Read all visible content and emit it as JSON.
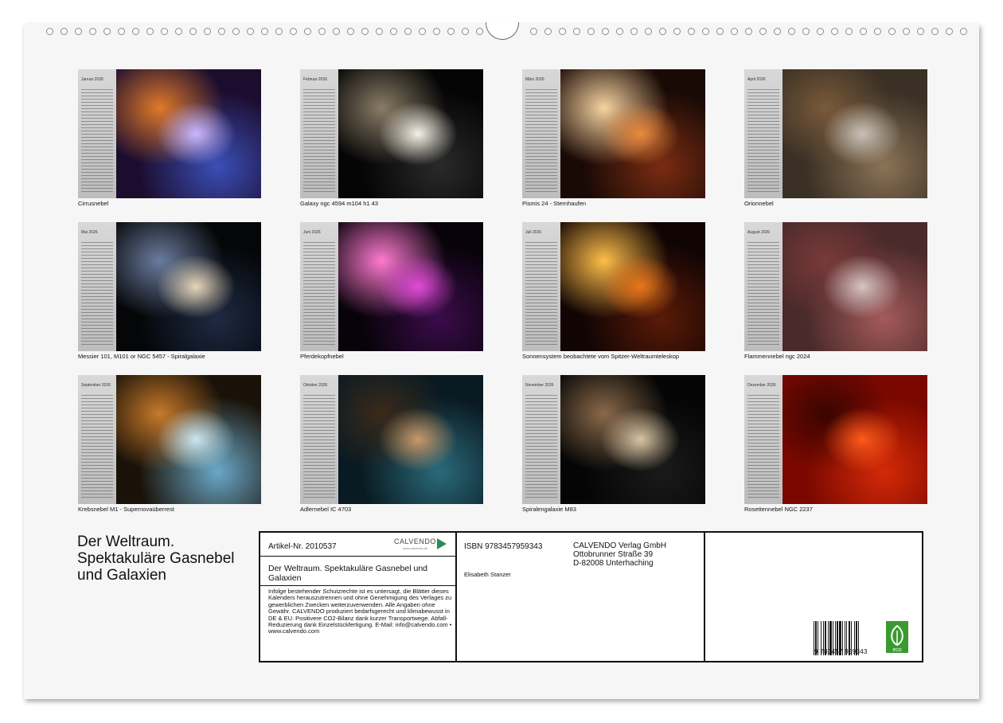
{
  "months": [
    {
      "label": "Januar 2026",
      "caption": "Cirrusnebel",
      "colors": [
        "#1c0d2e",
        "#3a4fb8",
        "#c9b6ff",
        "#e07a2a"
      ]
    },
    {
      "label": "Februar 2026",
      "caption": "Galaxy ngc 4594 m104 h1 43",
      "colors": [
        "#050505",
        "#2a2a2a",
        "#f4f1e6",
        "#8a7c66"
      ]
    },
    {
      "label": "März 2026",
      "caption": "Pismis 24 - Sternhaufen",
      "colors": [
        "#1a0a06",
        "#7a2c12",
        "#e88a3c",
        "#f6d3a0"
      ]
    },
    {
      "label": "April 2026",
      "caption": "Orionnebel",
      "colors": [
        "#3a3025",
        "#8b7356",
        "#c9c2b8",
        "#7a5a3a"
      ]
    },
    {
      "label": "Mai 2026",
      "caption": "Messier 101, M101 or NGC 5457 - Spiralgalaxie",
      "colors": [
        "#050608",
        "#1e2a44",
        "#e6d6b8",
        "#6a7c9e"
      ]
    },
    {
      "label": "Juni 2026",
      "caption": "Pferdekopfnebel",
      "colors": [
        "#08030a",
        "#3a0c4a",
        "#e04ad8",
        "#ff7ad0"
      ]
    },
    {
      "label": "Juli 2026",
      "caption": "Sonnensystem beobachtete vom Spitzer-Weltraumteleskop",
      "colors": [
        "#110503",
        "#5a1a08",
        "#e8761a",
        "#ffbe4a"
      ]
    },
    {
      "label": "August 2026",
      "caption": "Flammennebel ngc 2024",
      "colors": [
        "#4a2a2a",
        "#a45a5a",
        "#d6c4c4",
        "#7a3a3a"
      ]
    },
    {
      "label": "September 2026",
      "caption": "Krebsnebel M1 - Supernovaüberrest",
      "colors": [
        "#1a1208",
        "#6aa8c8",
        "#c8e6f0",
        "#c87a2a"
      ]
    },
    {
      "label": "Oktober 2026",
      "caption": "Adlernebel IC 4703",
      "colors": [
        "#0a1a22",
        "#2a6a7a",
        "#c89a6a",
        "#3a2a1a"
      ]
    },
    {
      "label": "November 2026",
      "caption": "Spiralengalaxie M83",
      "colors": [
        "#050505",
        "#1a1a1a",
        "#d8c4a4",
        "#8a6a4a"
      ]
    },
    {
      "label": "Dezember 2026",
      "caption": "Rosettennebel NGC 2237",
      "colors": [
        "#7a0800",
        "#d42a08",
        "#ff5a1a",
        "#3a0500"
      ]
    }
  ],
  "title": "Der Weltraum. Spektakuläre Gasnebel und Galaxien",
  "info": {
    "article": "Artikel-Nr. 2010537",
    "logo_text": "CALVENDO",
    "logo_sub": "www.calvendo.de",
    "subtitle": "Der Weltraum. Spektakuläre Gasnebel und Galaxien",
    "legal": "Infolge bestehender Schutzrechte ist es untersagt, die Blätter dieses Kalenders herauszutrennen und ohne Genehmigung des Verlages zu gewerblichen Zwecken weiterzuverwenden. Alle Angaben ohne Gewähr. CALVENDO produziert bedarfsgerecht und klimabewusst in DE & EU. Positivere CO2-Bilanz dank kurzer Transportwege. Abfall-Reduzierung dank Einzelstückfertigung. E-Mail: info@calvendo.com • www.calvendo.com",
    "isbn": "ISBN 9783457959343",
    "author": "Elisabeth Stanzer",
    "publisher_line1": "CALVENDO Verlag GmbH",
    "publisher_line2": "Ottobrunner Straße 39",
    "publisher_line3": "D-82008 Unterhaching",
    "barcode_number": "9 783457 959343",
    "eco_label": "eco"
  },
  "icons": {
    "eco": "leaf-icon",
    "logo": "calvendo-triangle-icon"
  }
}
